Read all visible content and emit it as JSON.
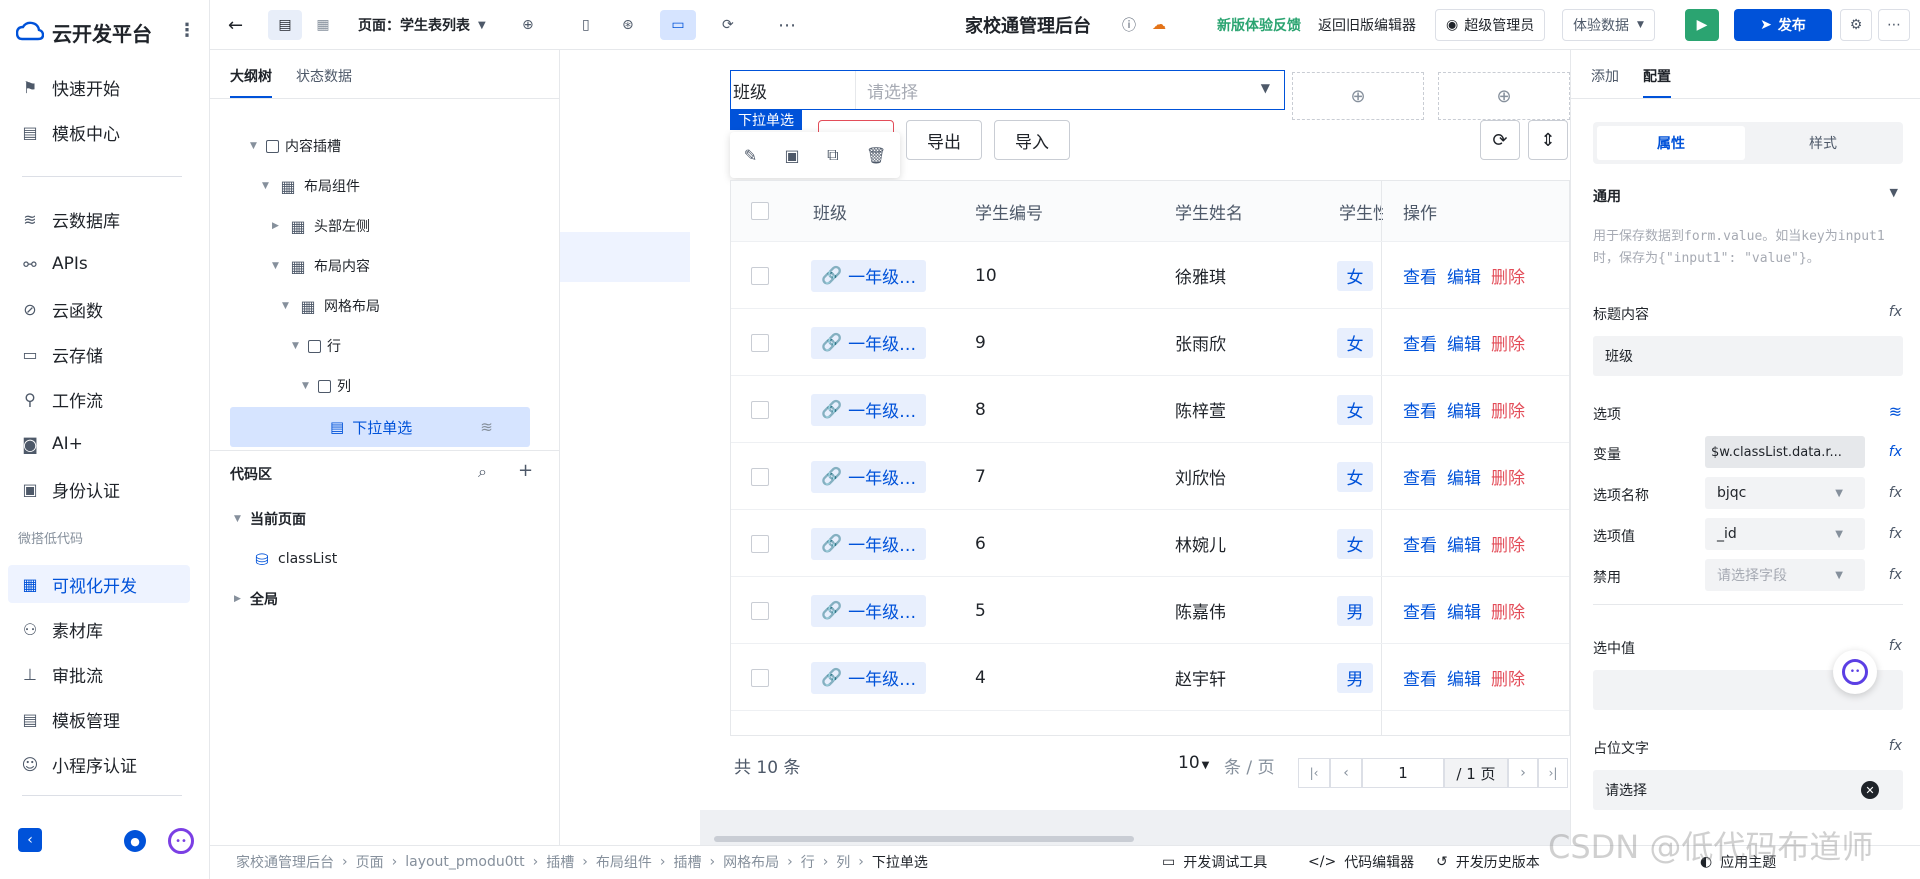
{
  "nav": {
    "brand": "云开发平台",
    "items": [
      {
        "label": "快速开始",
        "icon": "flag-icon"
      },
      {
        "label": "模板中心",
        "icon": "template-icon"
      },
      {
        "label": "云数据库",
        "icon": "database-icon"
      },
      {
        "label": "APIs",
        "icon": "api-icon"
      },
      {
        "label": "云函数",
        "icon": "function-icon"
      },
      {
        "label": "云存储",
        "icon": "folder-icon"
      },
      {
        "label": "工作流",
        "icon": "workflow-icon"
      },
      {
        "label": "AI+",
        "icon": "robot-icon"
      },
      {
        "label": "身份认证",
        "icon": "id-card-icon"
      },
      {
        "label": "可视化开发",
        "icon": "layout-icon"
      },
      {
        "label": "素材库",
        "icon": "people-icon"
      },
      {
        "label": "审批流",
        "icon": "stamp-icon"
      },
      {
        "label": "模板管理",
        "icon": "template-manage-icon"
      },
      {
        "label": "小程序认证",
        "icon": "miniprogram-icon"
      }
    ],
    "section_label": "微搭低代码"
  },
  "topbar": {
    "page_label": "页面：学生表列表",
    "app_title": "家校通管理后台",
    "feedback": "新版体验反馈",
    "old_editor": "返回旧版编辑器",
    "admin": "超级管理员",
    "data_select": "体验数据",
    "publish": "发布"
  },
  "outline": {
    "tabs": [
      "大纲树",
      "状态数据"
    ],
    "tree": [
      {
        "label": "内容插槽"
      },
      {
        "label": "布局组件"
      },
      {
        "label": "头部左侧"
      },
      {
        "label": "布局内容"
      },
      {
        "label": "网格布局"
      },
      {
        "label": "行"
      },
      {
        "label": "列"
      },
      {
        "label": "下拉单选"
      }
    ],
    "code_title": "代码区",
    "current_page": "当前页面",
    "class_list": "classList",
    "global": "全局"
  },
  "canvas": {
    "form_label": "班级",
    "placeholder": "请选择",
    "component_tag": "下拉单选",
    "export": "导出",
    "import": "导入",
    "table": {
      "headers": [
        "班级",
        "学生编号",
        "学生姓名",
        "学生性",
        "操作"
      ],
      "rows": [
        {
          "cls": "一年级…",
          "id": "10",
          "name": "徐雅琪",
          "sex": "女"
        },
        {
          "cls": "一年级…",
          "id": "9",
          "name": "张雨欣",
          "sex": "女"
        },
        {
          "cls": "一年级…",
          "id": "8",
          "name": "陈梓萱",
          "sex": "女"
        },
        {
          "cls": "一年级…",
          "id": "7",
          "name": "刘欣怡",
          "sex": "女"
        },
        {
          "cls": "一年级…",
          "id": "6",
          "name": "林婉儿",
          "sex": "女"
        },
        {
          "cls": "一年级…",
          "id": "5",
          "name": "陈嘉伟",
          "sex": "男"
        },
        {
          "cls": "一年级…",
          "id": "4",
          "name": "赵宇轩",
          "sex": "男"
        }
      ],
      "actions": {
        "view": "查看",
        "edit": "编辑",
        "delete": "删除"
      }
    },
    "pager": {
      "total_prefix": "共",
      "total": "10",
      "total_suffix": "条",
      "page_size": "10",
      "per_page": "条 / 页",
      "page": "1",
      "pages": "/ 1 页"
    }
  },
  "right": {
    "tabs": [
      "添加",
      "配置"
    ],
    "sub_tabs": [
      "属性",
      "样式"
    ],
    "section": "通用",
    "hint": "用于保存数据到form.value。如当key为input1时，保存为{\"input1\": \"value\"}。",
    "title_label": "标题内容",
    "title_value": "班级",
    "options_label": "选项",
    "var_label": "变量",
    "var_value": "$w.classList.data.r...",
    "opt_name_label": "选项名称",
    "opt_name_value": "bjqc",
    "opt_value_label": "选项值",
    "opt_value_value": "_id",
    "disable_label": "禁用",
    "disable_placeholder": "请选择字段",
    "selected_label": "选中值",
    "placeholder_label": "占位文字",
    "placeholder_value": "请选择"
  },
  "bottom": {
    "crumbs": [
      "家校通管理后台",
      "页面",
      "layout_pmodu0tt",
      "插槽",
      "布局组件",
      "插槽",
      "网格布局",
      "行",
      "列",
      "下拉单选"
    ],
    "dev_tools": "开发调试工具",
    "code_editor": "代码编辑器",
    "history": "开发历史版本",
    "theme": "应用主题"
  },
  "watermark": "CSDN @低代码布道师"
}
